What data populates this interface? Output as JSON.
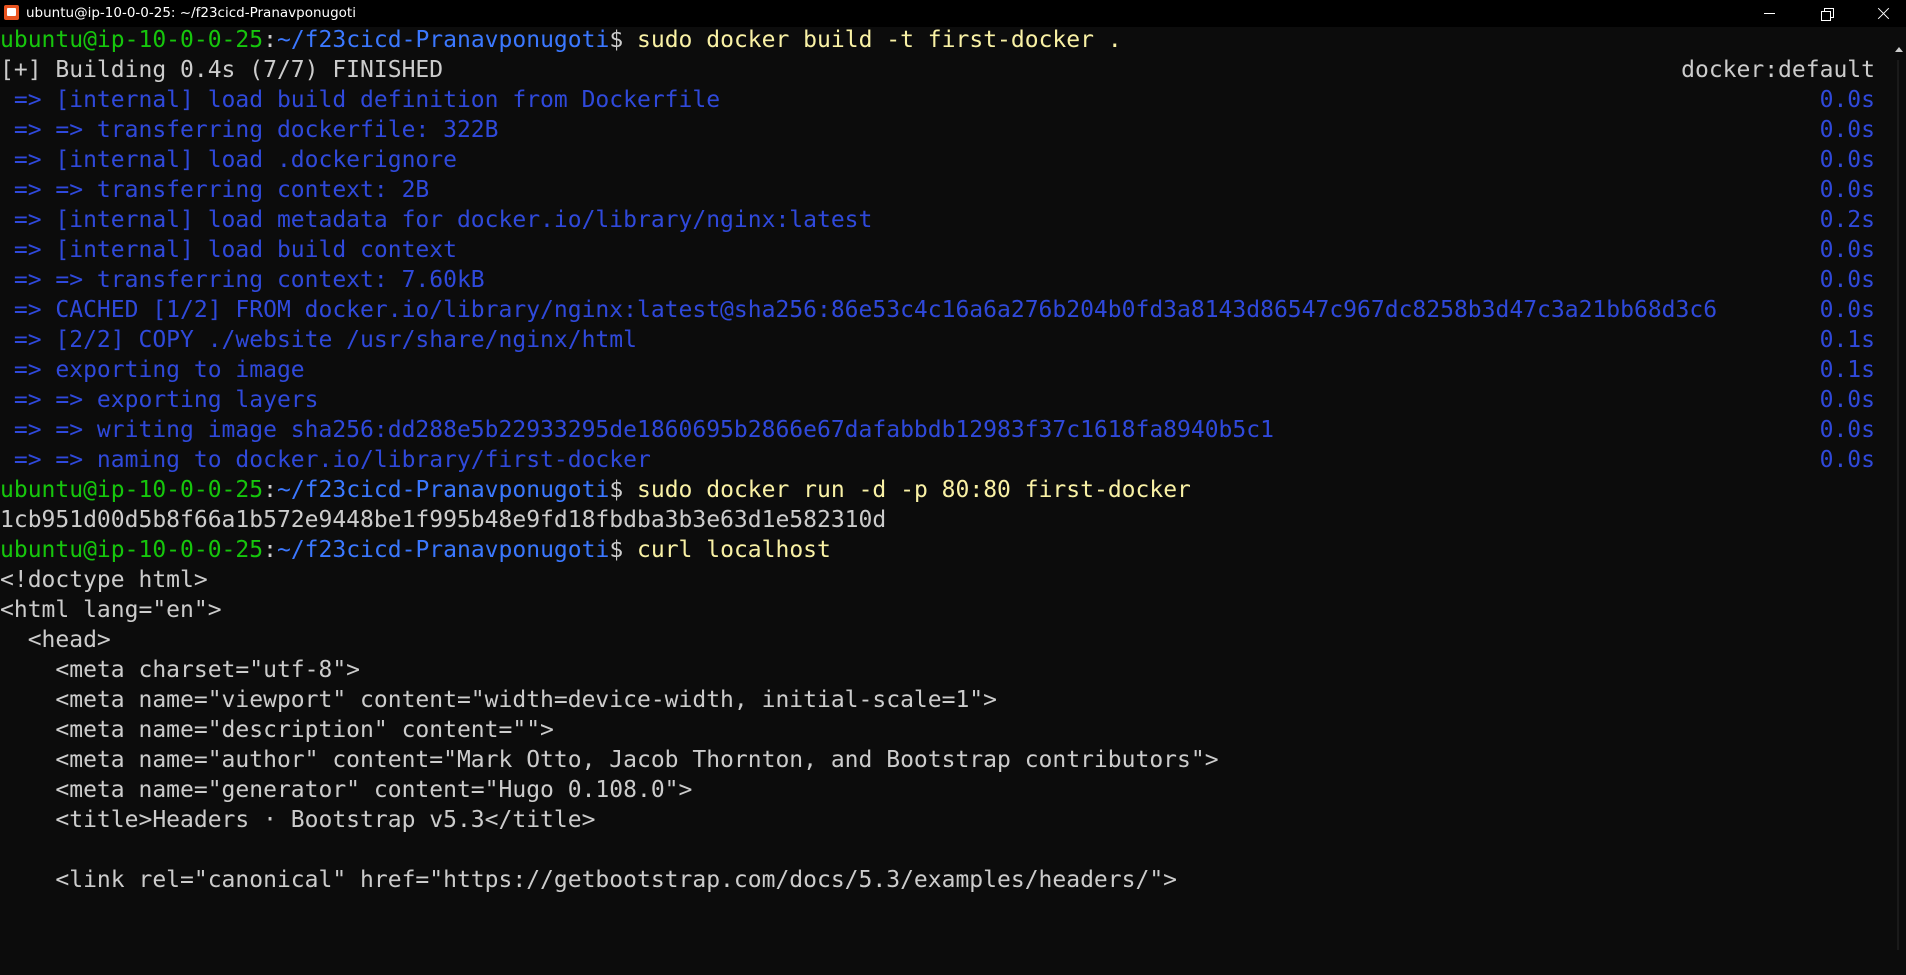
{
  "window": {
    "title": "ubuntu@ip-10-0-0-25: ~/f23cicd-Pranavponugoti"
  },
  "colors": {
    "background": "#0c0c0c",
    "prompt_user": "#16c60c",
    "prompt_path": "#3b78ff",
    "command": "#f9f1a5",
    "build_output": "#2f49db",
    "text": "#cccccc"
  },
  "terminal": {
    "prompt": {
      "user": "ubuntu@ip-10-0-0-25",
      "sep": ":",
      "path": "~/f23cicd-Pranavponugoti",
      "symbol": "$ "
    },
    "cmd1": "sudo docker build -t first-docker .",
    "build_header": {
      "left": "[+] Building 0.4s (7/7) FINISHED",
      "right": "docker:default"
    },
    "build_steps": [
      {
        "text": " => [internal] load build definition from Dockerfile",
        "time": "0.0s"
      },
      {
        "text": " => => transferring dockerfile: 322B",
        "time": "0.0s"
      },
      {
        "text": " => [internal] load .dockerignore",
        "time": "0.0s"
      },
      {
        "text": " => => transferring context: 2B",
        "time": "0.0s"
      },
      {
        "text": " => [internal] load metadata for docker.io/library/nginx:latest",
        "time": "0.2s"
      },
      {
        "text": " => [internal] load build context",
        "time": "0.0s"
      },
      {
        "text": " => => transferring context: 7.60kB",
        "time": "0.0s"
      },
      {
        "text": " => CACHED [1/2] FROM docker.io/library/nginx:latest@sha256:86e53c4c16a6a276b204b0fd3a8143d86547c967dc8258b3d47c3a21bb68d3c6",
        "time": "0.0s"
      },
      {
        "text": " => [2/2] COPY ./website /usr/share/nginx/html",
        "time": "0.1s"
      },
      {
        "text": " => exporting to image",
        "time": "0.1s"
      },
      {
        "text": " => => exporting layers",
        "time": "0.0s"
      },
      {
        "text": " => => writing image sha256:dd288e5b22933295de1860695b2866e67dafabbdb12983f37c1618fa8940b5c1",
        "time": "0.0s"
      },
      {
        "text": " => => naming to docker.io/library/first-docker",
        "time": "0.0s"
      }
    ],
    "cmd2": "sudo docker run -d -p 80:80 first-docker",
    "container_id": "1cb951d00d5b8f66a1b572e9448be1f995b48e9fd18fbdba3b3e63d1e582310d",
    "cmd3": "curl localhost",
    "html_output": [
      "<!doctype html>",
      "<html lang=\"en\">",
      "  <head>",
      "    <meta charset=\"utf-8\">",
      "    <meta name=\"viewport\" content=\"width=device-width, initial-scale=1\">",
      "    <meta name=\"description\" content=\"\">",
      "    <meta name=\"author\" content=\"Mark Otto, Jacob Thornton, and Bootstrap contributors\">",
      "    <meta name=\"generator\" content=\"Hugo 0.108.0\">",
      "    <title>Headers · Bootstrap v5.3</title>",
      "",
      "    <link rel=\"canonical\" href=\"https://getbootstrap.com/docs/5.3/examples/headers/\">"
    ]
  }
}
